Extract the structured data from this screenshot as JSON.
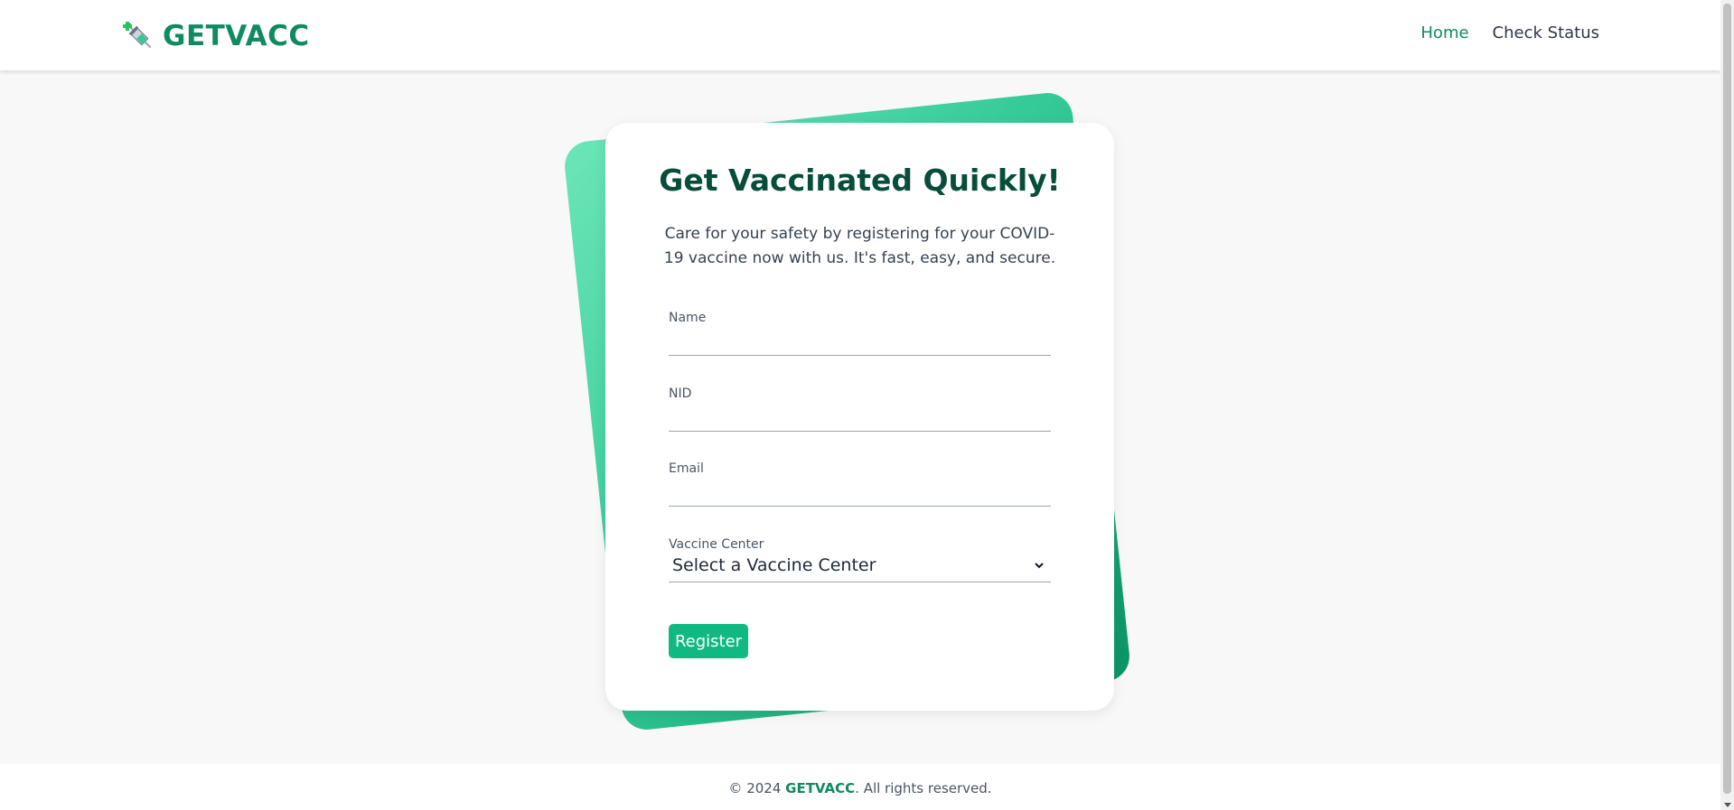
{
  "header": {
    "brand": "GETVACC",
    "nav": [
      {
        "label": "Home",
        "active": true
      },
      {
        "label": "Check Status",
        "active": false
      }
    ]
  },
  "card": {
    "title": "Get Vaccinated Quickly!",
    "description": "Care for your safety by registering for your COVID-19 vaccine now with us. It's fast, easy, and secure.",
    "fields": {
      "name_label": "Name",
      "nid_label": "NID",
      "email_label": "Email",
      "center_label": "Vaccine Center",
      "center_selected": "Select a Vaccine Center"
    },
    "register_label": "Register"
  },
  "footer": {
    "prefix": "© 2024 ",
    "brand": "GETVACC",
    "suffix": ". All rights reserved."
  },
  "colors": {
    "brand": "#0f8a61",
    "button": "#10b981",
    "title": "#064e3b",
    "background": "#f8f8f8"
  },
  "icons": {
    "brand": "syringe-icon",
    "select": "chevron-down-icon"
  }
}
